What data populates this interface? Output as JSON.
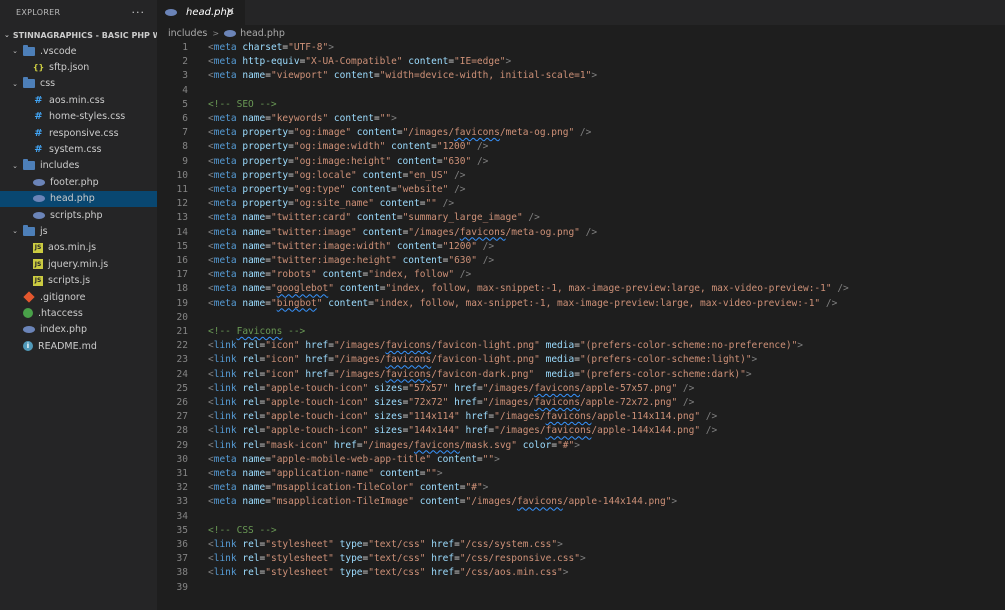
{
  "explorer": {
    "title": "EXPLORER",
    "more": "···",
    "root": "STINNAGRAPHICS - BASIC PHP W...",
    "items": [
      {
        "label": ".vscode",
        "type": "folder",
        "depth": 1,
        "open": true
      },
      {
        "label": "sftp.json",
        "type": "json",
        "depth": 2
      },
      {
        "label": "css",
        "type": "folder",
        "depth": 1,
        "open": true
      },
      {
        "label": "aos.min.css",
        "type": "css",
        "depth": 2
      },
      {
        "label": "home-styles.css",
        "type": "css",
        "depth": 2
      },
      {
        "label": "responsive.css",
        "type": "css",
        "depth": 2
      },
      {
        "label": "system.css",
        "type": "css",
        "depth": 2
      },
      {
        "label": "includes",
        "type": "folder",
        "depth": 1,
        "open": true
      },
      {
        "label": "footer.php",
        "type": "php",
        "depth": 2
      },
      {
        "label": "head.php",
        "type": "php",
        "depth": 2,
        "selected": true
      },
      {
        "label": "scripts.php",
        "type": "php",
        "depth": 2
      },
      {
        "label": "js",
        "type": "folder",
        "depth": 1,
        "open": true
      },
      {
        "label": "aos.min.js",
        "type": "js",
        "depth": 2
      },
      {
        "label": "jquery.min.js",
        "type": "js",
        "depth": 2
      },
      {
        "label": "scripts.js",
        "type": "js",
        "depth": 2
      },
      {
        "label": ".gitignore",
        "type": "git",
        "depth": 1
      },
      {
        "label": ".htaccess",
        "type": "htaccess",
        "depth": 1
      },
      {
        "label": "index.php",
        "type": "php",
        "depth": 1
      },
      {
        "label": "README.md",
        "type": "info",
        "depth": 1
      }
    ]
  },
  "tab": {
    "label": "head.php",
    "close": "✕"
  },
  "breadcrumb": {
    "folder": "includes",
    "file": "head.php",
    "separator": ">"
  },
  "editor": {
    "lines": [
      "<meta charset=\"UTF-8\">",
      "<meta http-equiv=\"X-UA-Compatible\" content=\"IE=edge\">",
      "<meta name=\"viewport\" content=\"width=device-width, initial-scale=1\">",
      "",
      "<!-- SEO -->",
      "<meta name=\"keywords\" content=\"\">",
      "<meta property=\"og:image\" content=\"/images/favicons/meta-og.png\" />",
      "<meta property=\"og:image:width\" content=\"1200\" />",
      "<meta property=\"og:image:height\" content=\"630\" />",
      "<meta property=\"og:locale\" content=\"en_US\" />",
      "<meta property=\"og:type\" content=\"website\" />",
      "<meta property=\"og:site_name\" content=\"\" />",
      "<meta name=\"twitter:card\" content=\"summary_large_image\" />",
      "<meta name=\"twitter:image\" content=\"/images/favicons/meta-og.png\" />",
      "<meta name=\"twitter:image:width\" content=\"1200\" />",
      "<meta name=\"twitter:image:height\" content=\"630\" />",
      "<meta name=\"robots\" content=\"index, follow\" />",
      "<meta name=\"googlebot\" content=\"index, follow, max-snippet:-1, max-image-preview:large, max-video-preview:-1\" />",
      "<meta name=\"bingbot\" content=\"index, follow, max-snippet:-1, max-image-preview:large, max-video-preview:-1\" />",
      "",
      "<!-- Favicons -->",
      "<link rel=\"icon\" href=\"/images/favicons/favicon-light.png\" media=\"(prefers-color-scheme:no-preference)\">",
      "<link rel=\"icon\" href=\"/images/favicons/favicon-light.png\" media=\"(prefers-color-scheme:light)\">",
      "<link rel=\"icon\" href=\"/images/favicons/favicon-dark.png\"  media=\"(prefers-color-scheme:dark)\">",
      "<link rel=\"apple-touch-icon\" sizes=\"57x57\" href=\"/images/favicons/apple-57x57.png\" />",
      "<link rel=\"apple-touch-icon\" sizes=\"72x72\" href=\"/images/favicons/apple-72x72.png\" />",
      "<link rel=\"apple-touch-icon\" sizes=\"114x114\" href=\"/images/favicons/apple-114x114.png\" />",
      "<link rel=\"apple-touch-icon\" sizes=\"144x144\" href=\"/images/favicons/apple-144x144.png\" />",
      "<link rel=\"mask-icon\" href=\"/images/favicons/mask.svg\" color=\"#\">",
      "<meta name=\"apple-mobile-web-app-title\" content=\"\">",
      "<meta name=\"application-name\" content=\"\">",
      "<meta name=\"msapplication-TileColor\" content=\"#\">",
      "<meta name=\"msapplication-TileImage\" content=\"/images/favicons/apple-144x144.png\">",
      "",
      "<!-- CSS -->",
      "<link rel=\"stylesheet\" type=\"text/css\" href=\"/css/system.css\">",
      "<link rel=\"stylesheet\" type=\"text/css\" href=\"/css/responsive.css\">",
      "<link rel=\"stylesheet\" type=\"text/css\" href=\"/css/aos.min.css\">",
      ""
    ]
  }
}
